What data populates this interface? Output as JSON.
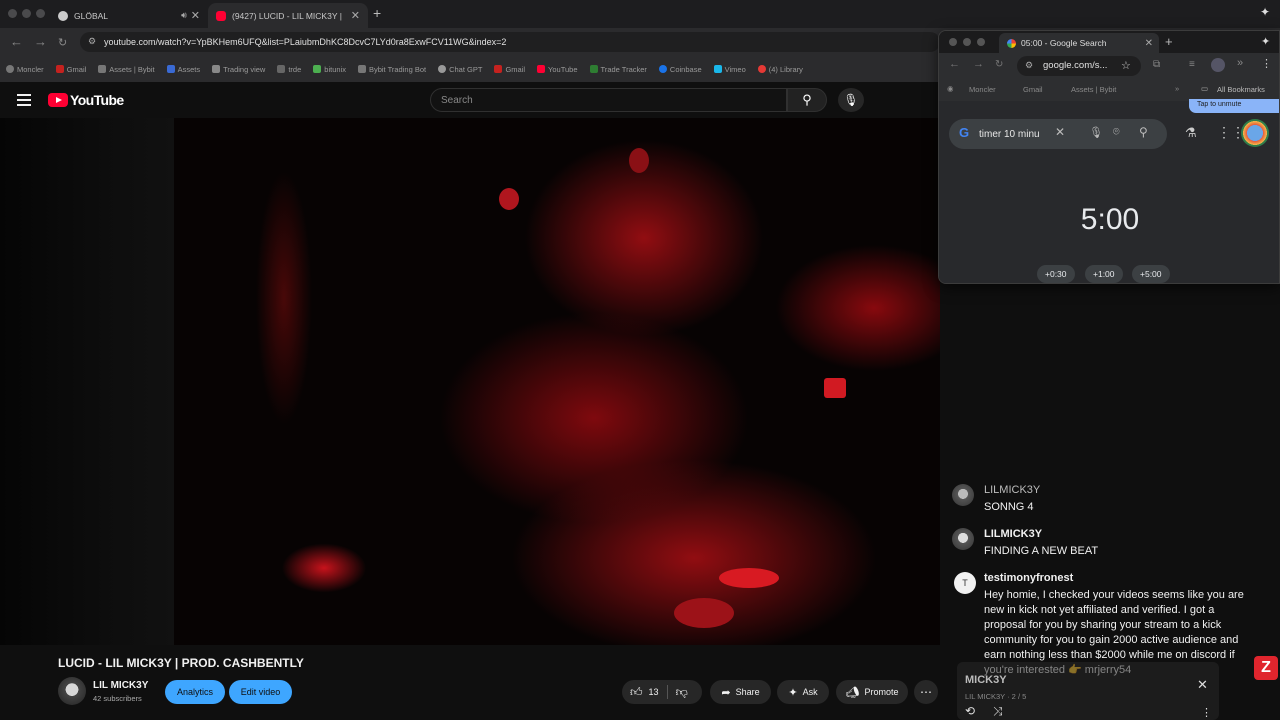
{
  "browser": {
    "tabs": [
      {
        "title": "GLÖBAL"
      },
      {
        "title": "(9427) LUCID - LIL MICK3Y |"
      }
    ],
    "url": "youtube.com/watch?v=YpBKHem6UFQ&list=PLaiubmDhKC8DcvC7LYd0ra8ExwFCV11WG&index=2",
    "bookmarks": [
      "Moncler",
      "Gmail",
      "Assets | Bybit",
      "Assets",
      "Trading view",
      "trde",
      "bitunix",
      "Bybit Trading Bot",
      "Chat GPT",
      "Gmail",
      "YouTube",
      "Trade Tracker",
      "Coinbase",
      "Vimeo",
      "(4) Library"
    ]
  },
  "youtube": {
    "logo_text": "YouTube",
    "search_placeholder": "Search",
    "video": {
      "title": "LUCID - LIL MICK3Y | PROD. CASHBENTLY",
      "channel": "LIL MICK3Y",
      "subscribers": "42 subscribers",
      "analytics_label": "Analytics",
      "edit_label": "Edit video",
      "like_count": "13",
      "share_label": "Share",
      "ask_label": "Ask",
      "promote_label": "Promote"
    }
  },
  "google_window": {
    "tab_title": "05:00 - Google Search",
    "url": "google.com/s...",
    "bookmarks": [
      "Moncler",
      "Gmail",
      "Assets | Bybit"
    ],
    "all_bookmarks": "All Bookmarks",
    "query": "timer 10 minu",
    "unmute_hint": "Tap to unmute",
    "timer": "5:00",
    "buttons": [
      "+0:30",
      "+1:00",
      "+5:00"
    ]
  },
  "chat": [
    {
      "user": "LILMICK3Y",
      "message": "SONNG 4"
    },
    {
      "user": "LILMICK3Y",
      "message": "FINDING A NEW BEAT"
    },
    {
      "user": "testimonyfronest",
      "initial": "T",
      "message": "Hey homie, I checked your videos seems like you are new in kick not yet affiliated and verified. I got a proposal for you by sharing your stream to a kick community for you to gain 2000 active audience and earn nothing less than $2000 while me on discord if you're interested 👉 mrjerry54"
    }
  ],
  "mini_player": {
    "title": "MICK3Y",
    "subtitle": "LIL MICK3Y · 2 / 5"
  },
  "colors": {
    "youtube_red": "#ff0033",
    "accent_blue": "#3ea6ff"
  }
}
